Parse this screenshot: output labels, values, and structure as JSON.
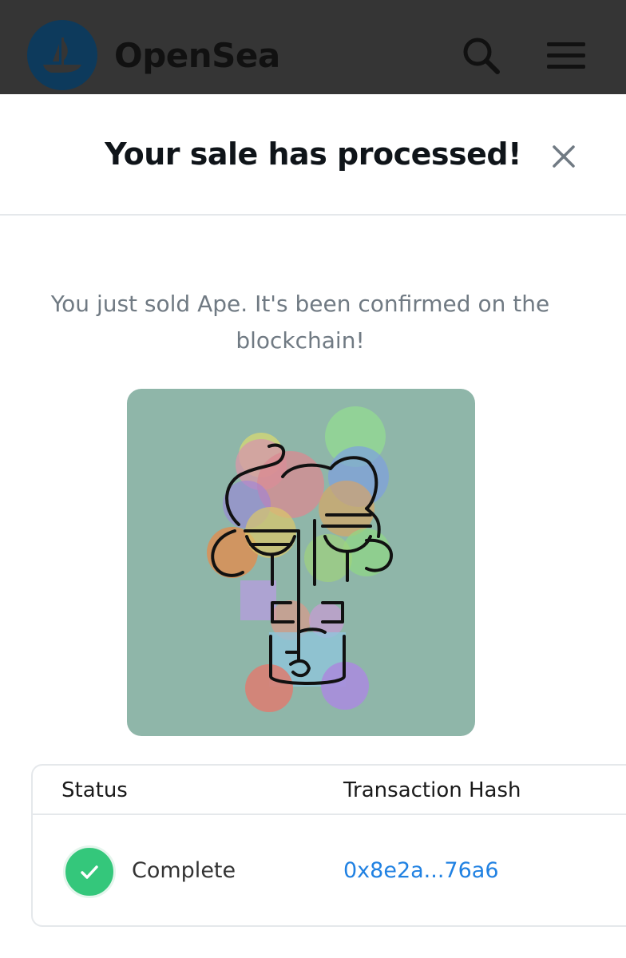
{
  "header": {
    "brand": "OpenSea",
    "logo_icon": "opensea-ship-icon",
    "search_icon": "search-icon",
    "menu_icon": "hamburger-menu-icon"
  },
  "modal": {
    "title": "Your sale has processed!",
    "close_icon": "close-icon",
    "message": "You just sold Ape. It's been confirmed on the blockchain!"
  },
  "artwork": {
    "name": "Ape",
    "background": "#8fb6a9"
  },
  "status_table": {
    "headers": [
      "Status",
      "Transaction Hash"
    ],
    "row": {
      "status": "Complete",
      "status_icon": "checkmark-icon",
      "transaction_hash": "0x8e2a...76a6"
    }
  },
  "colors": {
    "navbar": "#353535",
    "logo": "#0d3a5c",
    "success": "#34c77b",
    "link": "#2081e2",
    "muted_text": "#707a83"
  }
}
